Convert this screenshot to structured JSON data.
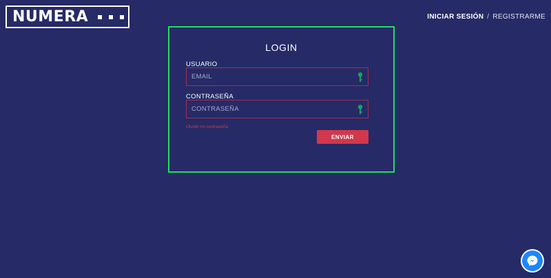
{
  "brand": {
    "name": "NUMERA"
  },
  "nav": {
    "login": "INICIAR SESIÓN",
    "separator": "/",
    "register": "REGISTRARME"
  },
  "login": {
    "title": "LOGIN",
    "user_label": "USUARIO",
    "email_placeholder": "EMAIL",
    "email_value": "",
    "password_label": "CONTRASEÑA",
    "password_placeholder": "CONTRASEÑA",
    "password_value": "",
    "forgot": "Olvidé mi contraseña",
    "submit": "ENVIAR"
  },
  "icons": {
    "field_icon": "key-icon",
    "chat": "messenger-icon"
  },
  "colors": {
    "background": "#262a66",
    "card_border": "#1ee060",
    "accent": "#d2374c",
    "field_border": "#a23052",
    "key": "#1aa35c",
    "messenger": "#1d87ff"
  }
}
